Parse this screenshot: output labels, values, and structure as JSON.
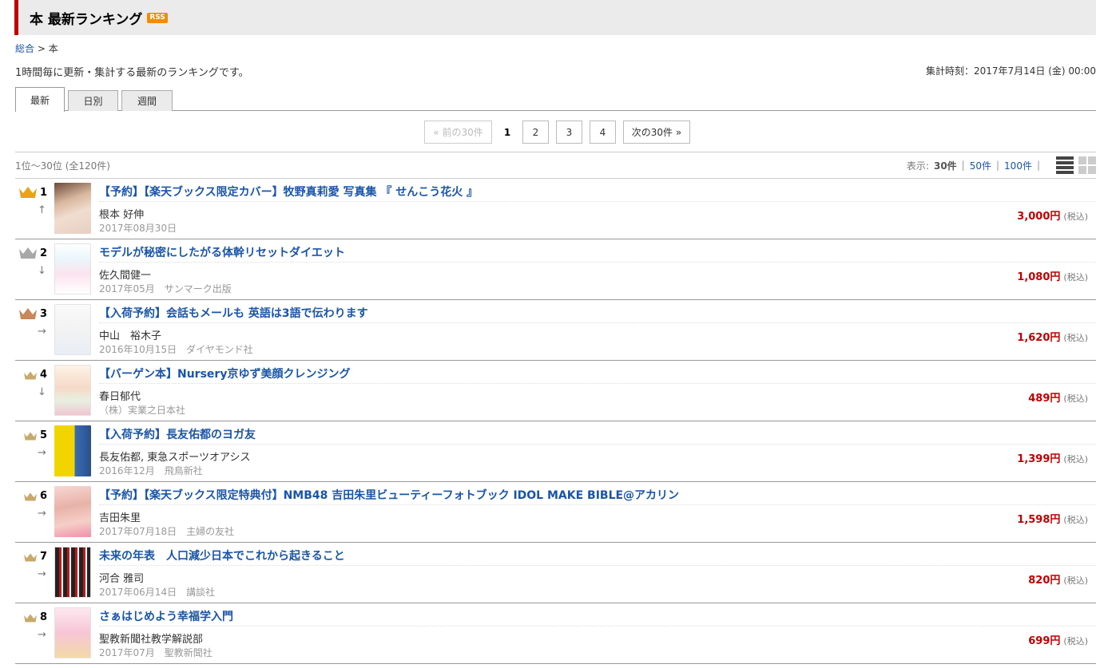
{
  "header": {
    "title": "本 最新ランキング",
    "rss": "RSS"
  },
  "breadcrumb": {
    "home": "総合",
    "separator": ">",
    "current": "本"
  },
  "description": "1時間毎に更新・集計する最新のランキングです。",
  "tally_time": "集計時刻：2017年7月14日 (金) 00:00",
  "tabs": [
    {
      "label": "最新",
      "active": true
    },
    {
      "label": "日別",
      "active": false
    },
    {
      "label": "週間",
      "active": false
    }
  ],
  "pager": {
    "prev": "« 前の30件",
    "pages": [
      "1",
      "2",
      "3",
      "4"
    ],
    "current": "1",
    "next": "次の30件 »"
  },
  "range": {
    "text": "1位～30位 (全120件)",
    "display_label": "表示:",
    "options": [
      "30件",
      "50件",
      "100件"
    ],
    "selected": "30件"
  },
  "items": [
    {
      "rank": "1",
      "trend": "↑",
      "crown": "gold",
      "title": "【予約】【楽天ブックス限定カバー】牧野真莉愛 写真集 『 せんこう花火 』",
      "author": "根本 好伸",
      "meta": "2017年08月30日",
      "price": "3,000円",
      "tax": "(税込)"
    },
    {
      "rank": "2",
      "trend": "↓",
      "crown": "silver",
      "title": "モデルが秘密にしたがる体幹リセットダイエット",
      "author": "佐久間健一",
      "meta": "2017年05月　サンマーク出版",
      "price": "1,080円",
      "tax": "(税込)"
    },
    {
      "rank": "3",
      "trend": "→",
      "crown": "bronze",
      "title": "【入荷予約】会話もメールも 英語は3語で伝わります",
      "author": "中山　裕木子",
      "meta": "2016年10月15日　ダイヤモンド社",
      "price": "1,620円",
      "tax": "(税込)"
    },
    {
      "rank": "4",
      "trend": "↓",
      "crown": "small",
      "title": "【バーゲン本】Nursery京ゆず美顔クレンジング",
      "author": "春日郁代",
      "meta": "（株）実業之日本社",
      "price": "489円",
      "tax": "(税込)"
    },
    {
      "rank": "5",
      "trend": "→",
      "crown": "small",
      "title": "【入荷予約】長友佑都のヨガ友",
      "author": "長友佑都, 東急スポーツオアシス",
      "meta": "2016年12月　飛鳥新社",
      "price": "1,399円",
      "tax": "(税込)"
    },
    {
      "rank": "6",
      "trend": "→",
      "crown": "small",
      "title": "【予約】【楽天ブックス限定特典付】NMB48 吉田朱里ビューティーフォトブック IDOL MAKE BIBLE@アカリン",
      "author": "吉田朱里",
      "meta": "2017年07月18日　主婦の友社",
      "price": "1,598円",
      "tax": "(税込)"
    },
    {
      "rank": "7",
      "trend": "→",
      "crown": "small",
      "title": "未来の年表　人口減少日本でこれから起きること",
      "author": "河合 雅司",
      "meta": "2017年06月14日　講談社",
      "price": "820円",
      "tax": "(税込)"
    },
    {
      "rank": "8",
      "trend": "→",
      "crown": "small",
      "title": "さぁはじめよう幸福学入門",
      "author": "聖教新聞社教学解説部",
      "meta": "2017年07月　聖教新聞社",
      "price": "699円",
      "tax": "(税込)"
    }
  ],
  "colors": {
    "accent": "#bf0000",
    "link": "#1a55a8",
    "gold": "#e8a317",
    "silver": "#a8a8a8",
    "bronze": "#c9875a",
    "small_crown": "#c8a96a"
  }
}
